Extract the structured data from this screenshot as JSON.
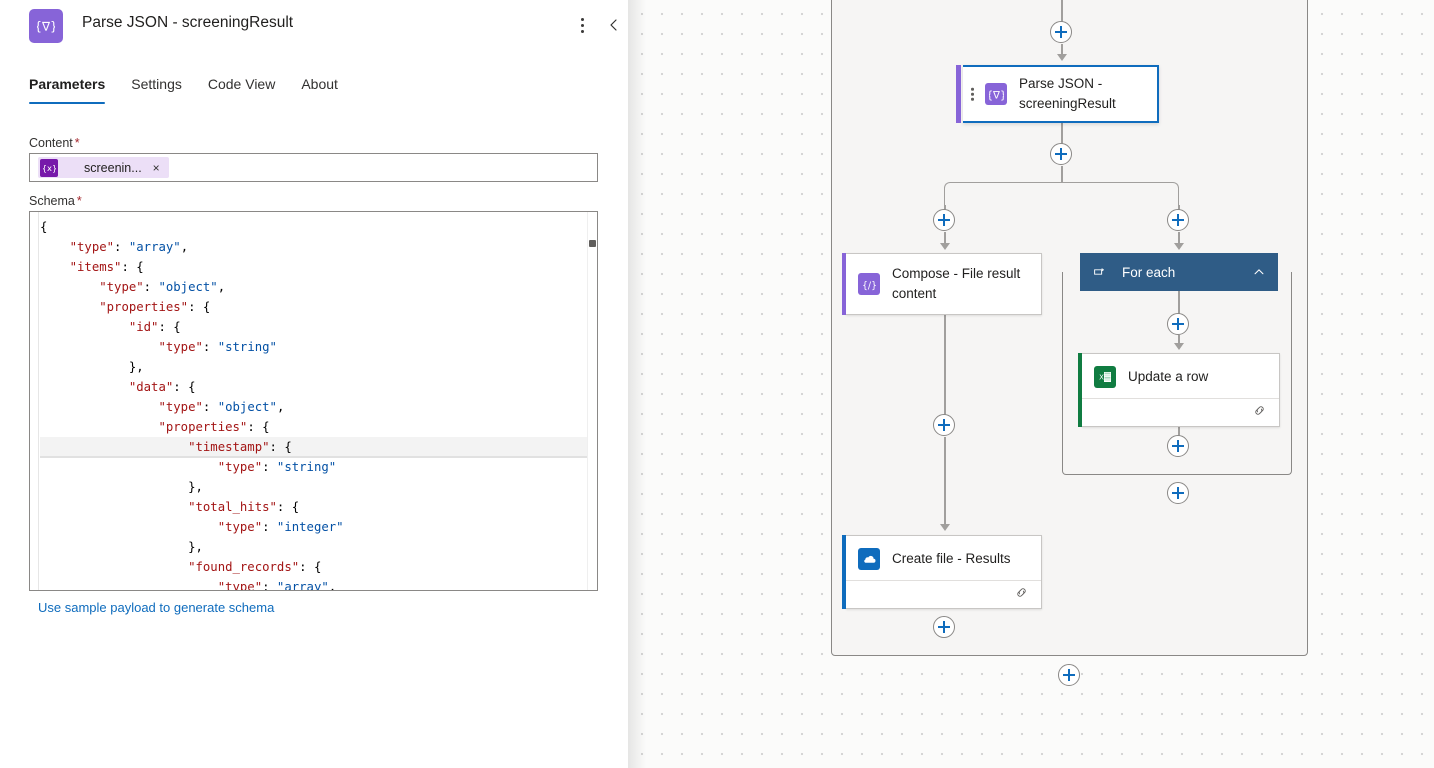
{
  "panel": {
    "title_action": "Parse JSON - ",
    "title_name": "screeningResult",
    "icon": "parse-json-icon",
    "more_icon": "more-vertical-icon",
    "collapse_icon": "chevron-left-icon",
    "tabs": [
      {
        "label": "Parameters",
        "active": true
      },
      {
        "label": "Settings",
        "active": false
      },
      {
        "label": "Code View",
        "active": false
      },
      {
        "label": "About",
        "active": false
      }
    ],
    "content_field": {
      "label": "Content",
      "required_marker": "*",
      "token_text": "screenin...",
      "token_icon": "expression-token-icon",
      "token_remove": "×"
    },
    "schema_field": {
      "label": "Schema",
      "required_marker": "*",
      "lines": [
        [
          [
            "p",
            "{"
          ]
        ],
        [
          [
            "p",
            "    "
          ],
          [
            "k",
            "\"type\""
          ],
          [
            "p",
            ": "
          ],
          [
            "s",
            "\"array\""
          ],
          [
            "p",
            ","
          ]
        ],
        [
          [
            "p",
            "    "
          ],
          [
            "k",
            "\"items\""
          ],
          [
            "p",
            ": {"
          ]
        ],
        [
          [
            "p",
            "        "
          ],
          [
            "k",
            "\"type\""
          ],
          [
            "p",
            ": "
          ],
          [
            "s",
            "\"object\""
          ],
          [
            "p",
            ","
          ]
        ],
        [
          [
            "p",
            "        "
          ],
          [
            "k",
            "\"properties\""
          ],
          [
            "p",
            ": {"
          ]
        ],
        [
          [
            "p",
            "            "
          ],
          [
            "k",
            "\"id\""
          ],
          [
            "p",
            ": {"
          ]
        ],
        [
          [
            "p",
            "                "
          ],
          [
            "k",
            "\"type\""
          ],
          [
            "p",
            ": "
          ],
          [
            "s",
            "\"string\""
          ]
        ],
        [
          [
            "p",
            "            },"
          ]
        ],
        [
          [
            "p",
            "            "
          ],
          [
            "k",
            "\"data\""
          ],
          [
            "p",
            ": {"
          ]
        ],
        [
          [
            "p",
            "                "
          ],
          [
            "k",
            "\"type\""
          ],
          [
            "p",
            ": "
          ],
          [
            "s",
            "\"object\""
          ],
          [
            "p",
            ","
          ]
        ],
        [
          [
            "p",
            "                "
          ],
          [
            "k",
            "\"properties\""
          ],
          [
            "p",
            ": {"
          ]
        ],
        [
          [
            "p",
            "                    "
          ],
          [
            "k",
            "\"timestamp\""
          ],
          [
            "p",
            ": {"
          ]
        ],
        [
          [
            "p",
            "                        "
          ],
          [
            "k",
            "\"type\""
          ],
          [
            "p",
            ": "
          ],
          [
            "s",
            "\"string\""
          ]
        ],
        [
          [
            "p",
            "                    },"
          ]
        ],
        [
          [
            "p",
            "                    "
          ],
          [
            "k",
            "\"total_hits\""
          ],
          [
            "p",
            ": {"
          ]
        ],
        [
          [
            "p",
            "                        "
          ],
          [
            "k",
            "\"type\""
          ],
          [
            "p",
            ": "
          ],
          [
            "s",
            "\"integer\""
          ]
        ],
        [
          [
            "p",
            "                    },"
          ]
        ],
        [
          [
            "p",
            "                    "
          ],
          [
            "k",
            "\"found_records\""
          ],
          [
            "p",
            ": {"
          ]
        ],
        [
          [
            "p",
            "                        "
          ],
          [
            "k",
            "\"type\""
          ],
          [
            "p",
            ": "
          ],
          [
            "s",
            "\"array\""
          ],
          [
            "p",
            ","
          ]
        ]
      ],
      "highlighted_line_index": 11
    },
    "sample_link": "Use sample payload to generate schema"
  },
  "canvas": {
    "nodes": {
      "parse_json": {
        "label_line1": "Parse JSON -",
        "label_line2": "screeningResult",
        "icon": "parse-json-icon",
        "accent": "#8764d8"
      },
      "compose": {
        "label_line1": "Compose - File result",
        "label_line2": "content",
        "icon": "compose-icon",
        "accent": "#8764d8"
      },
      "for_each": {
        "label": "For each",
        "icon": "loop-icon",
        "chevron": "chevron-up-icon",
        "header_color": "#2f5c86"
      },
      "update_row": {
        "label": "Update a row",
        "icon": "excel-icon",
        "accent": "#107c41",
        "footer_icon": "link-icon"
      },
      "create_file": {
        "label": "Create file - Results",
        "icon": "onedrive-icon",
        "accent": "#0f6cbd",
        "footer_icon": "link-icon"
      }
    },
    "add_buttons_count": 9,
    "add_button_icon": "plus-icon"
  }
}
